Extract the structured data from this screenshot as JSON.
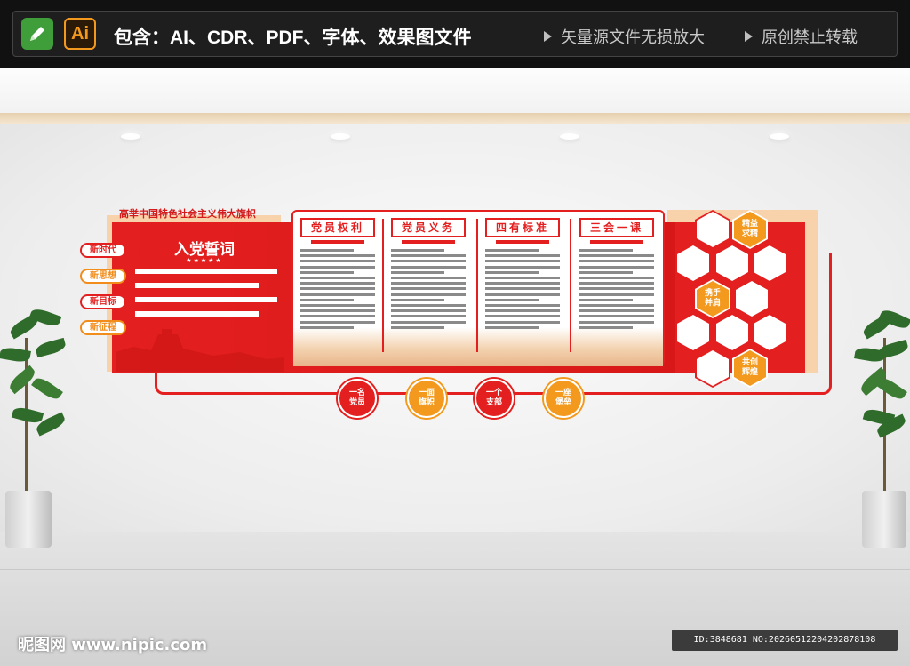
{
  "banner": {
    "app1_icon": "pencil-icon",
    "app2_label": "Ai",
    "title": "包含：AI、CDR、PDF、字体、效果图文件",
    "note1": "矢量源文件无损放大",
    "note2": "原创禁止转载"
  },
  "wall": {
    "slogan": "高举中国特色社会主义伟大旗帜",
    "oath_title": "入党誓词",
    "oath_stars": "★★★★★",
    "tags": [
      "新时代",
      "新思想",
      "新目标",
      "新征程"
    ],
    "columns": [
      "党员权利",
      "党员义务",
      "四有标准",
      "三会一课"
    ],
    "hexes": [
      "精益\n求精",
      "携手\n并肩",
      "共创\n辉煌"
    ],
    "circles": [
      "一名\n党员",
      "一面\n旗帜",
      "一个\n支部",
      "一座\n堡垒"
    ]
  },
  "footer": {
    "site": "昵图网 www.nipic.com",
    "id_text": "ID:3848681 NO:20260512204202878108"
  },
  "colors": {
    "red": "#e41f1f",
    "orange": "#f39a1e",
    "peach": "#f8d2ab"
  }
}
